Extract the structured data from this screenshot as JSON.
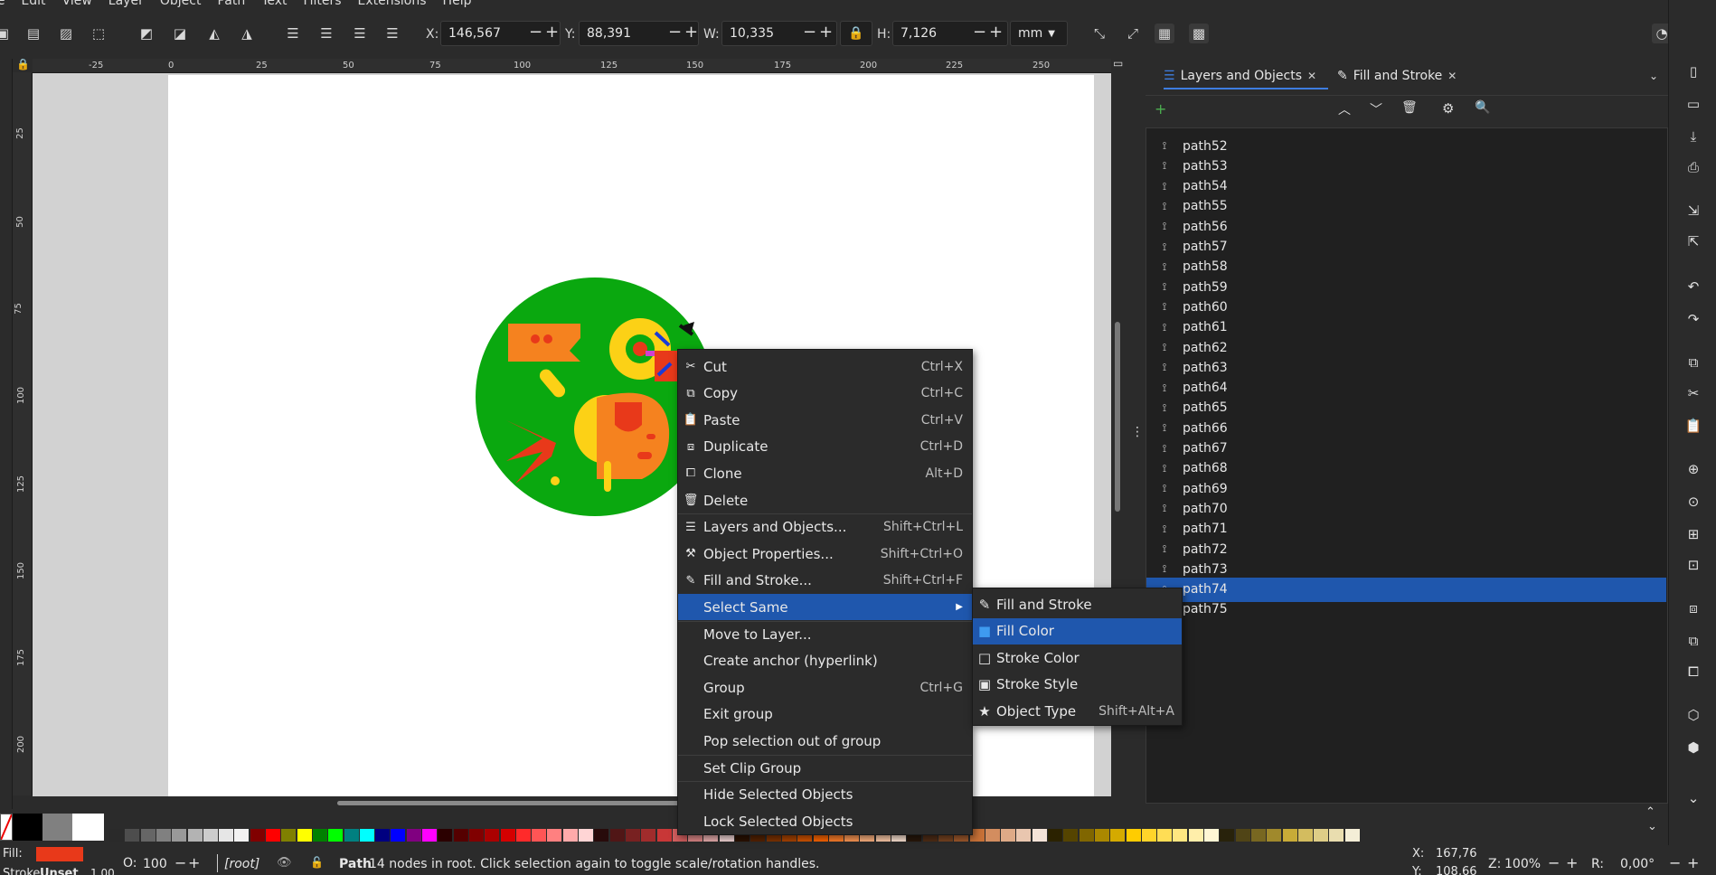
{
  "menubar": [
    "File",
    "Edit",
    "View",
    "Layer",
    "Object",
    "Path",
    "Text",
    "Filters",
    "Extensions",
    "Help"
  ],
  "toolbar": {
    "x_label": "X:",
    "x_value": "146,567",
    "y_label": "Y:",
    "y_value": "88,391",
    "w_label": "W:",
    "w_value": "10,335",
    "h_label": "H:",
    "h_value": "7,126",
    "unit": "mm"
  },
  "hruler_ticks": [
    "-25",
    "0",
    "25",
    "50",
    "75",
    "100",
    "125",
    "150",
    "175",
    "200",
    "225",
    "250"
  ],
  "vruler_ticks": [
    "25",
    "50",
    "75",
    "100",
    "125",
    "150",
    "175",
    "200"
  ],
  "dock": {
    "tab1": "Layers and Objects",
    "tab2": "Fill and Stroke",
    "items": [
      "path52",
      "path53",
      "path54",
      "path55",
      "path56",
      "path57",
      "path58",
      "path59",
      "path60",
      "path61",
      "path62",
      "path63",
      "path64",
      "path65",
      "path66",
      "path67",
      "path68",
      "path69",
      "path70",
      "path71",
      "path72",
      "path73",
      "path74",
      "path75"
    ],
    "selected": "path74"
  },
  "context_menu": [
    {
      "label": "Cut",
      "shortcut": "Ctrl+X",
      "icon": "scissors-icon"
    },
    {
      "label": "Copy",
      "shortcut": "Ctrl+C",
      "icon": "copy-icon"
    },
    {
      "label": "Paste",
      "shortcut": "Ctrl+V",
      "icon": "paste-icon"
    },
    {
      "label": "Duplicate",
      "shortcut": "Ctrl+D",
      "icon": "duplicate-icon"
    },
    {
      "label": "Clone",
      "shortcut": "Alt+D",
      "icon": "clone-icon"
    },
    {
      "label": "Delete",
      "shortcut": "",
      "icon": "trash-icon"
    },
    {
      "label": "Layers and Objects...",
      "shortcut": "Shift+Ctrl+L",
      "icon": "layers-icon"
    },
    {
      "label": "Object Properties...",
      "shortcut": "Shift+Ctrl+O",
      "icon": "object-properties-icon"
    },
    {
      "label": "Fill and Stroke...",
      "shortcut": "Shift+Ctrl+F",
      "icon": "fill-stroke-icon"
    },
    {
      "label": "Select Same",
      "shortcut": "",
      "icon": ""
    },
    {
      "label": "Move to Layer...",
      "shortcut": "",
      "icon": ""
    },
    {
      "label": "Create anchor (hyperlink)",
      "shortcut": "",
      "icon": ""
    },
    {
      "label": "Group",
      "shortcut": "Ctrl+G",
      "icon": ""
    },
    {
      "label": "Exit group",
      "shortcut": "",
      "icon": ""
    },
    {
      "label": "Pop selection out of group",
      "shortcut": "",
      "icon": ""
    },
    {
      "label": "Set Clip Group",
      "shortcut": "",
      "icon": ""
    },
    {
      "label": "Hide Selected Objects",
      "shortcut": "",
      "icon": ""
    },
    {
      "label": "Lock Selected Objects",
      "shortcut": "",
      "icon": ""
    }
  ],
  "submenu": [
    {
      "label": "Fill and Stroke",
      "shortcut": "",
      "icon": "fill-stroke-icon"
    },
    {
      "label": "Fill Color",
      "shortcut": "",
      "icon": "fill-color-icon"
    },
    {
      "label": "Stroke Color",
      "shortcut": "",
      "icon": "stroke-color-icon"
    },
    {
      "label": "Stroke Style",
      "shortcut": "",
      "icon": "stroke-style-icon"
    },
    {
      "label": "Object Type",
      "shortcut": "Shift+Alt+A",
      "icon": "star-icon"
    }
  ],
  "statusbar": {
    "fill_label": "Fill:",
    "stroke_label": "Stroke:",
    "stroke_value": "Unset",
    "stroke_width": "1,00",
    "opacity_label": "O:",
    "opacity_value": "100",
    "layer": "[root]",
    "message_bold": "Path",
    "message": " 14 nodes in root. Click selection again to toggle scale/rotation handles.",
    "x_label": "X:",
    "x_value": "167,76",
    "y_label": "Y:",
    "y_value": "108,66",
    "zoom_label": "Z:",
    "zoom_value": "100%",
    "rotation_label": "R:",
    "rotation_value": "0,00°"
  },
  "colors": {
    "accent": "#1f57ad",
    "fill_swatch": "#e8391a",
    "circle": "#0aa80f"
  }
}
